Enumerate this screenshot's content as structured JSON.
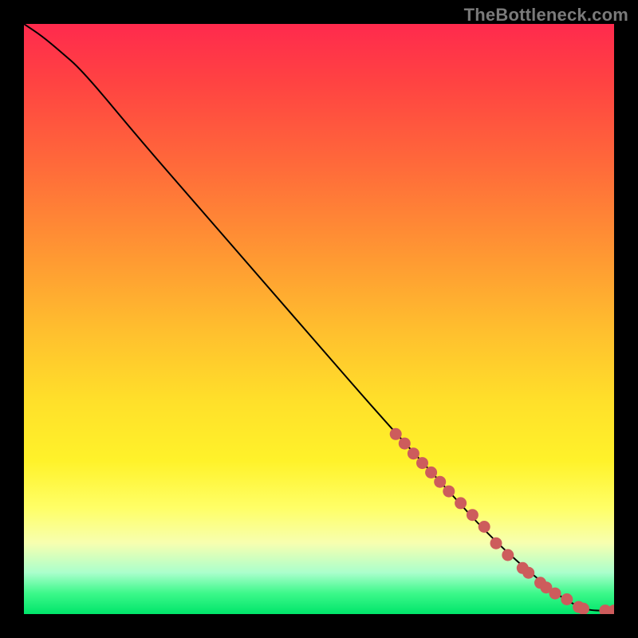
{
  "watermark": "TheBottleneck.com",
  "chart_data": {
    "type": "line",
    "title": "",
    "xlabel": "",
    "ylabel": "",
    "xlim": [
      0,
      100
    ],
    "ylim": [
      0,
      100
    ],
    "grid": false,
    "legend": null,
    "series": [
      {
        "name": "curve",
        "kind": "line",
        "x": [
          0,
          3,
          6,
          10,
          20,
          30,
          40,
          50,
          60,
          70,
          80,
          90,
          94,
          96,
          100
        ],
        "y": [
          100,
          98,
          95.5,
          92,
          80,
          68.5,
          57,
          45.5,
          34,
          23,
          12,
          3.5,
          1.2,
          0.6,
          0.6
        ]
      },
      {
        "name": "points",
        "kind": "scatter",
        "x": [
          63.0,
          64.5,
          66.0,
          67.5,
          69.0,
          70.5,
          72.0,
          74.0,
          76.0,
          78.0,
          80.0,
          82.0,
          84.5,
          85.5,
          87.5,
          88.5,
          90.0,
          92.0,
          94.0,
          94.8,
          98.5,
          100.0
        ],
        "y": [
          30.5,
          28.9,
          27.2,
          25.6,
          24.0,
          22.4,
          20.8,
          18.8,
          16.8,
          14.8,
          12.0,
          10.0,
          7.8,
          7.0,
          5.3,
          4.5,
          3.5,
          2.5,
          1.2,
          0.9,
          0.6,
          0.6
        ]
      }
    ],
    "background_gradient": {
      "direction": "vertical",
      "stops": [
        {
          "pos": 0.0,
          "color": "#ff2a4d"
        },
        {
          "pos": 0.24,
          "color": "#ff6a3a"
        },
        {
          "pos": 0.52,
          "color": "#ffbf2e"
        },
        {
          "pos": 0.74,
          "color": "#fff22a"
        },
        {
          "pos": 0.88,
          "color": "#f7ffb0"
        },
        {
          "pos": 0.96,
          "color": "#3cf88a"
        },
        {
          "pos": 1.0,
          "color": "#00e56a"
        }
      ]
    }
  }
}
